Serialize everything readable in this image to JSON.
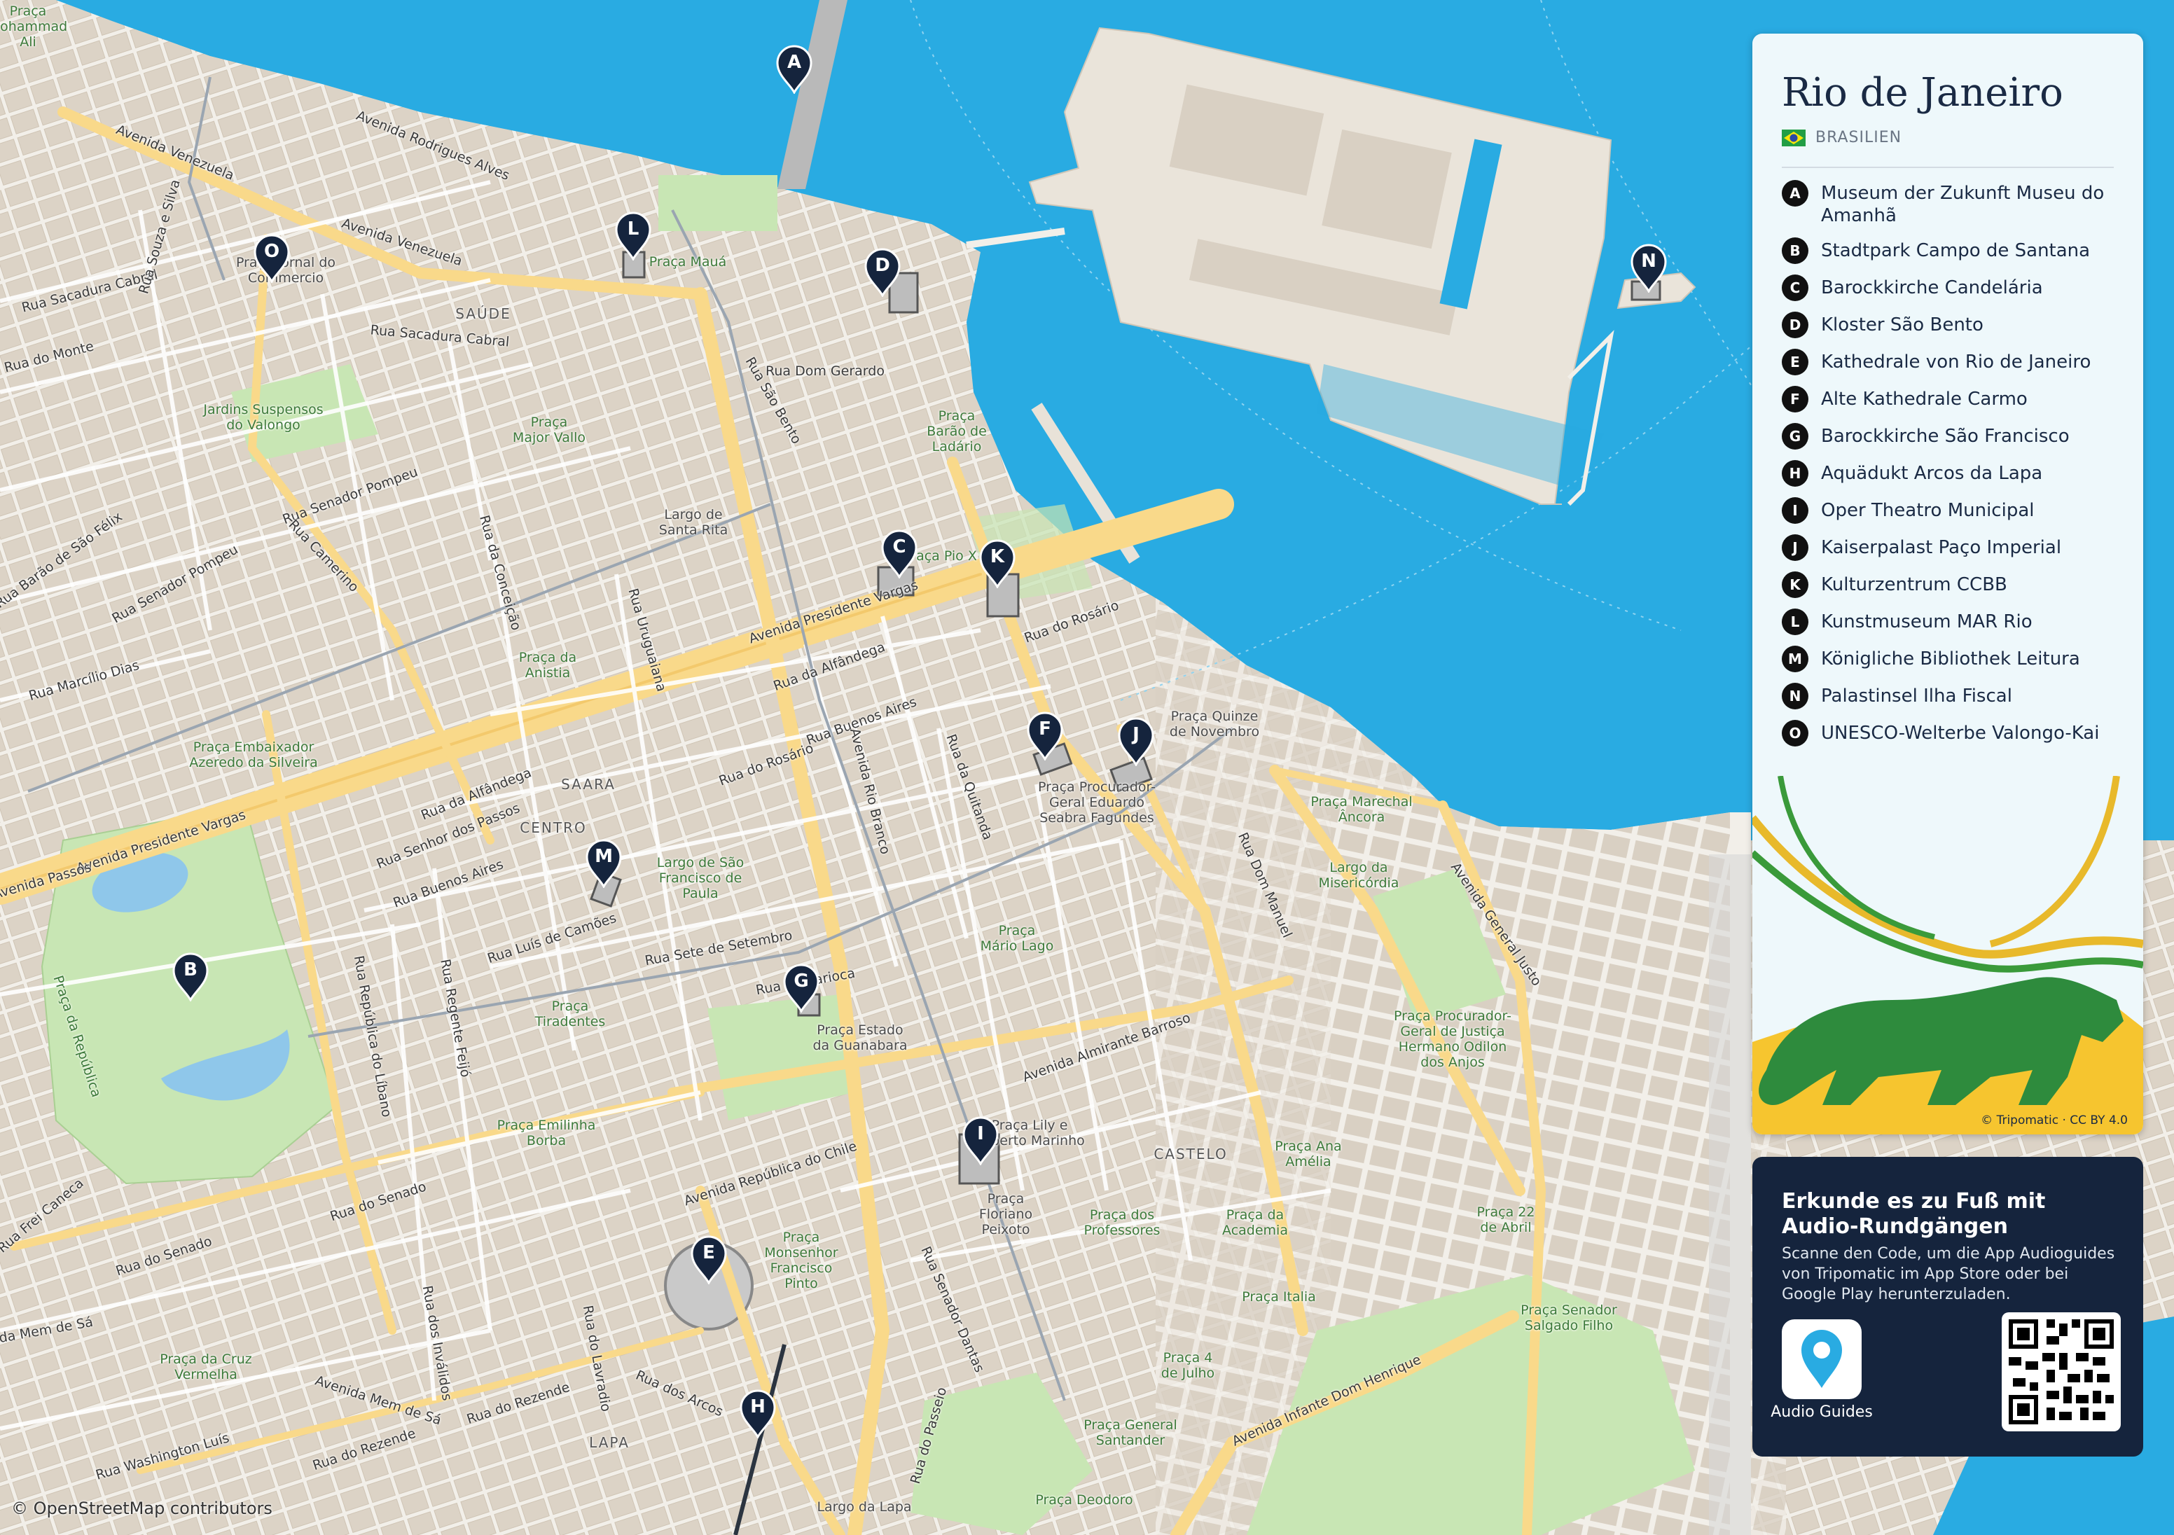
{
  "title": "Rio de Janeiro",
  "country": "BRASILIEN",
  "pois": [
    {
      "letter": "A",
      "name": "Museum der Zukunft Museu do Amanhã"
    },
    {
      "letter": "B",
      "name": "Stadtpark Campo de Santana"
    },
    {
      "letter": "C",
      "name": "Barockkirche Candelária"
    },
    {
      "letter": "D",
      "name": "Kloster São Bento"
    },
    {
      "letter": "E",
      "name": "Kathedrale von Rio de Janeiro"
    },
    {
      "letter": "F",
      "name": "Alte Kathedrale Carmo"
    },
    {
      "letter": "G",
      "name": "Barockkirche São Francisco"
    },
    {
      "letter": "H",
      "name": "Aquädukt Arcos da Lapa"
    },
    {
      "letter": "I",
      "name": "Oper Theatro Municipal"
    },
    {
      "letter": "J",
      "name": "Kaiserpalast Paço Imperial"
    },
    {
      "letter": "K",
      "name": "Kulturzentrum CCBB"
    },
    {
      "letter": "L",
      "name": "Kunstmuseum MAR Rio"
    },
    {
      "letter": "M",
      "name": "Königliche Bibliothek Leitura"
    },
    {
      "letter": "N",
      "name": "Palastinsel Ilha Fiscal"
    },
    {
      "letter": "O",
      "name": "UNESCO-Welterbe Valongo-Kai"
    }
  ],
  "image_credit": "© Tripomatic · CC BY 4.0",
  "promo": {
    "heading": "Erkunde es zu Fuß mit Audio-Rundgängen",
    "body": "Scanne den Code, um die App Audioguides von Tripomatic im App Store oder bei Google Play herunterzuladen.",
    "app_label": "Audio Guides"
  },
  "map_attribution": "© OpenStreetMap contributors",
  "districts": [
    "SAÚDE",
    "SAARA",
    "CENTRO",
    "CASTELO",
    "LAPA"
  ],
  "place_labels": [
    "Praça Mauá",
    "Praça Barão de Ladário",
    "Largo de Santa Rita",
    "Praça Pio X",
    "Praça Quinze de Novembro",
    "Praça Procurador-Geral Eduardo Seabra Fagundes",
    "Praça Marechal Âncora",
    "Largo da Misericórdia",
    "Praça Mário Lago",
    "Largo de São Francisco de Paula",
    "Praça Tiradentes",
    "Praça Estado da Guanabara",
    "Praça da República",
    "Praça da Anistia",
    "Praça Embaixador Azeredo da Silveira",
    "Jardins Suspensos do Valongo",
    "Praça Major Vallo",
    "Praça Emilinha Borba",
    "Praça Monsenhor Francisco Pinto",
    "Praça Floriano Peixoto",
    "Praça dos Professores",
    "Praça da Academia",
    "Praça Ana Amélia",
    "Praça Procurador-Geral de Justiça Hermano Odilon dos Anjos",
    "Praça 22 de Abril",
    "Praça Italia",
    "Praça 4 de Julho",
    "Praça Senador Salgado Filho",
    "Praça General Santander",
    "Praça Deodoro",
    "Largo da Lapa",
    "Praça da Cruz Vermelha",
    "Praça Mohammad Ali",
    "Praça Jornal do Commercio",
    "Praça Lily e Roberto Marinho"
  ],
  "street_labels": [
    "Avenida Rodrigues Alves",
    "Avenida Venezuela",
    "Rua Sacadura Cabral",
    "Rua São Bento",
    "Rua Dom Gerardo",
    "Avenida Presidente Vargas",
    "Rua Uruguaiana",
    "Rua da Alfândega",
    "Rua Buenos Aires",
    "Avenida Rio Branco",
    "Rua da Quitanda",
    "Rua do Rosário",
    "Rua Sete de Setembro",
    "Rua Luís de Camões",
    "Avenida Almirante Barroso",
    "Avenida República do Chile",
    "Rua Senador Dantas",
    "Rua do Passeio",
    "Avenida Infante Dom Henrique",
    "Avenida General Justo",
    "Rua Dom Manuel",
    "Rua Senador Pompeu",
    "Rua Camerino",
    "Rua Marcílio Dias",
    "Rua Barão de São Félix",
    "Rua Regente Feijó",
    "Rua República do Líbano",
    "Rua do Senado",
    "Rua dos Inválidos",
    "Rua do Lavradio",
    "Avenida Mem de Sá",
    "Rua do Rezende",
    "Rua Washington Luís",
    "Rua dos Arcos",
    "Rua Frei Caneca",
    "Rua Senhor dos Passos",
    "Rua da Carioca",
    "Rua da Conceição",
    "Rua do Monte",
    "Rua Souza e Silva",
    "Avenida Passos"
  ],
  "colors": {
    "water": "#29abe2",
    "land": "#f2efe9",
    "park": "#c8e6b4",
    "major_road": "#f9d98a",
    "panel": "#eef8fb",
    "promo": "#15243d",
    "marker": "#15243d"
  }
}
